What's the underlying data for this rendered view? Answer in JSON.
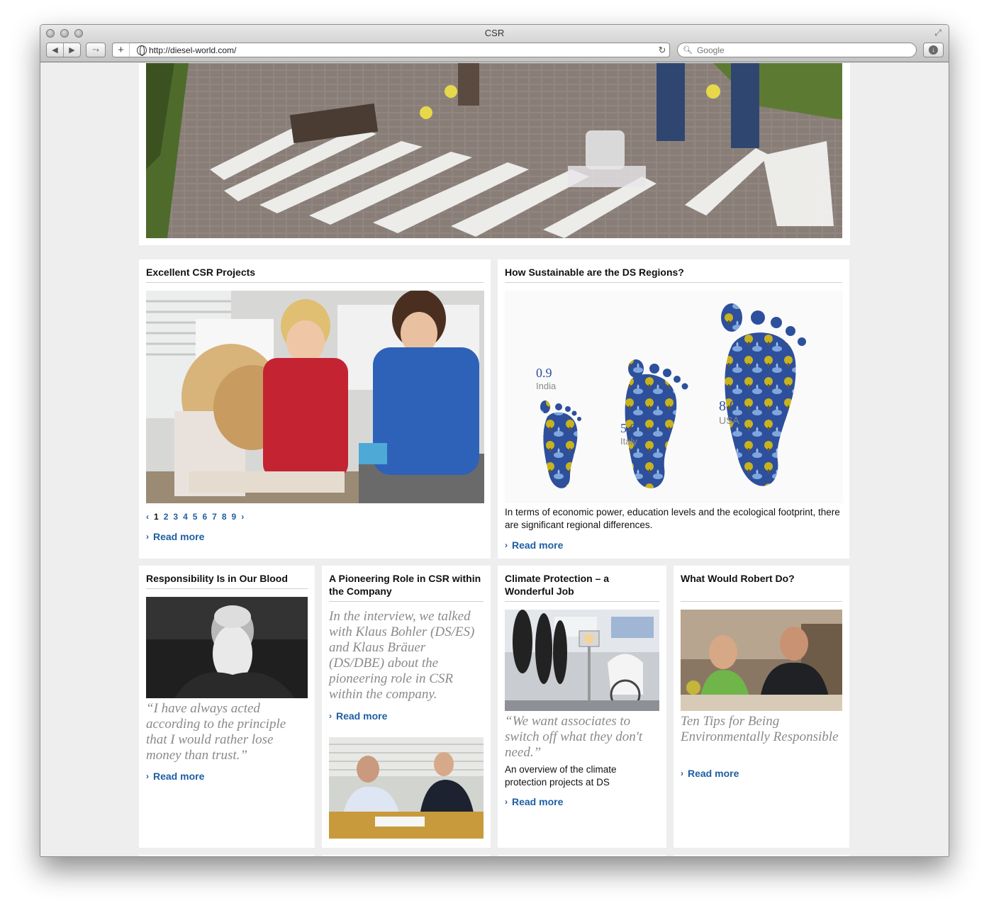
{
  "browser": {
    "window_title": "CSR",
    "url": "http://diesel-world.com/",
    "search_placeholder": "Google"
  },
  "featured": {
    "title": "Excellent CSR Projects",
    "pages": [
      "1",
      "2",
      "3",
      "4",
      "5",
      "6",
      "7",
      "8",
      "9"
    ],
    "current_page": "1",
    "read_more": "Read more"
  },
  "regions": {
    "title": "How Sustainable are the DS Regions?",
    "footprints": [
      {
        "value": "0.9",
        "label": "India"
      },
      {
        "value": "5.0",
        "label": "Italy"
      },
      {
        "value": "8.0",
        "label": "USA"
      }
    ],
    "description": "In terms of economic power, education levels and the ecological footprint, there are significant regional differences.",
    "read_more": "Read more"
  },
  "cards": [
    {
      "title": "Responsibility Is in Our Blood",
      "quote": "“I have always acted according to the principle that I would rather lose money than trust.”",
      "read_more": "Read more"
    },
    {
      "title": "A Pioneering Role in CSR within the Company",
      "quote": "In the interview, we talked with Klaus Bohler (DS/ES) and Klaus Bräuer (DS/DBE) about the pioneering role in CSR within the company.",
      "read_more": "Read more"
    },
    {
      "title": "Climate Protection – a Wonderful Job",
      "quote": "“We want associates to switch off what they don't need.”",
      "text": "An overview of the climate protection projects at DS",
      "read_more": "Read more"
    },
    {
      "title": "What Would Robert Do?",
      "quote": "Ten Tips for Being Environmentally Responsible",
      "read_more": "Read more"
    }
  ]
}
